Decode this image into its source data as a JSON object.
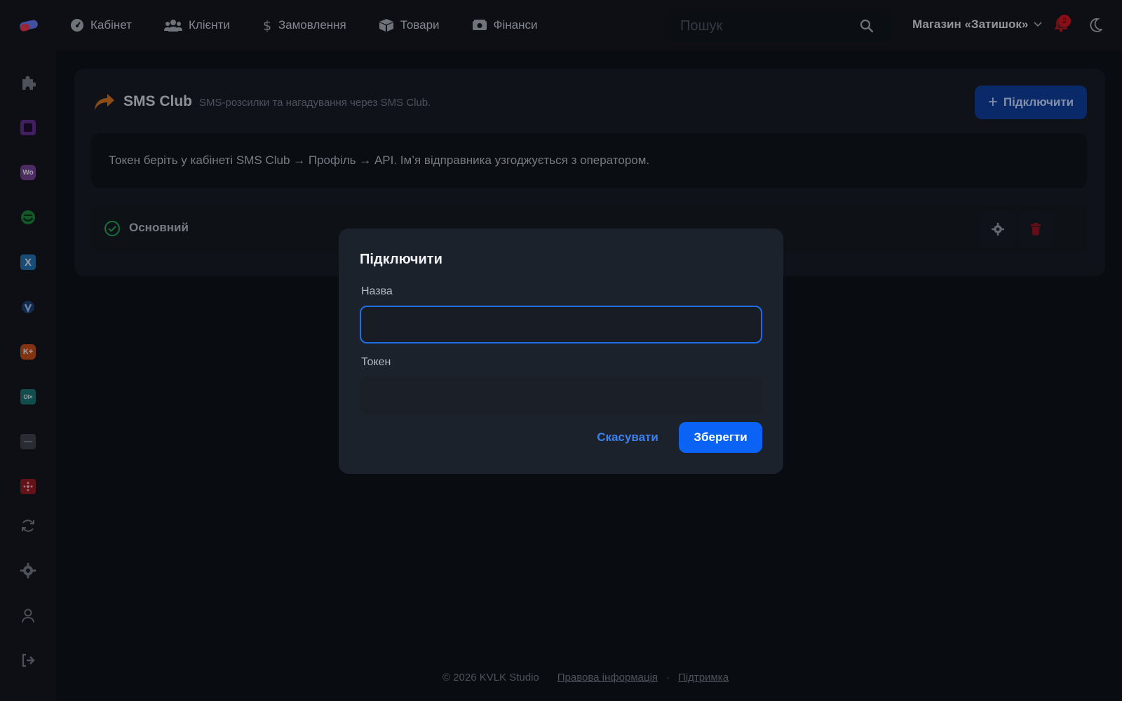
{
  "topbar": {
    "nav": [
      {
        "label": "Кабінет",
        "icon": "dashboard-icon"
      },
      {
        "label": "Клієнти",
        "icon": "users-icon"
      },
      {
        "label": "Замовлення",
        "icon": "dollar-icon"
      },
      {
        "label": "Товари",
        "icon": "box-icon"
      },
      {
        "label": "Фінанси",
        "icon": "money-icon"
      }
    ],
    "search_placeholder": "Пошук",
    "store_name": "Магазин «Затишок»",
    "notifications_count": "2"
  },
  "sidebar": {
    "items": [
      "puzzle-icon",
      "square-app-icon",
      "woo-app-icon",
      "smile-app-icon",
      "x-app-icon",
      "shield-app-icon",
      "kplus-app-icon",
      "olx-app-icon",
      "image-app-icon",
      "network-app-icon",
      "sync-icon",
      "settings-icon",
      "user-icon",
      "logout-icon"
    ],
    "tiles": {
      "woo": "Wo",
      "x": "X",
      "kplus": "K+",
      "olx": "OI×"
    }
  },
  "card": {
    "title": "SMS Club",
    "subtitle": "SMS-розсилки та нагадування через SMS Club.",
    "connect_label": "Підключити",
    "info_text": "Токен беріть у кабінеті SMS Club → Профіль → API. Ім’я відправника узгоджується з оператором.",
    "row_name": "Основний"
  },
  "modal": {
    "title": "Підключити",
    "name_label": "Назва",
    "name_value": "",
    "token_label": "Токен",
    "token_value": "",
    "cancel_label": "Скасувати",
    "save_label": "Зберегти"
  },
  "footer": {
    "copyright": "© 2026 KVLK Studio",
    "legal": "Правова інформація",
    "separator": "·",
    "support": "Підтримка"
  },
  "colors": {
    "accent": "#0a63f5",
    "background": "#0d1117",
    "danger": "#c0141e",
    "success": "#1f9d55"
  }
}
